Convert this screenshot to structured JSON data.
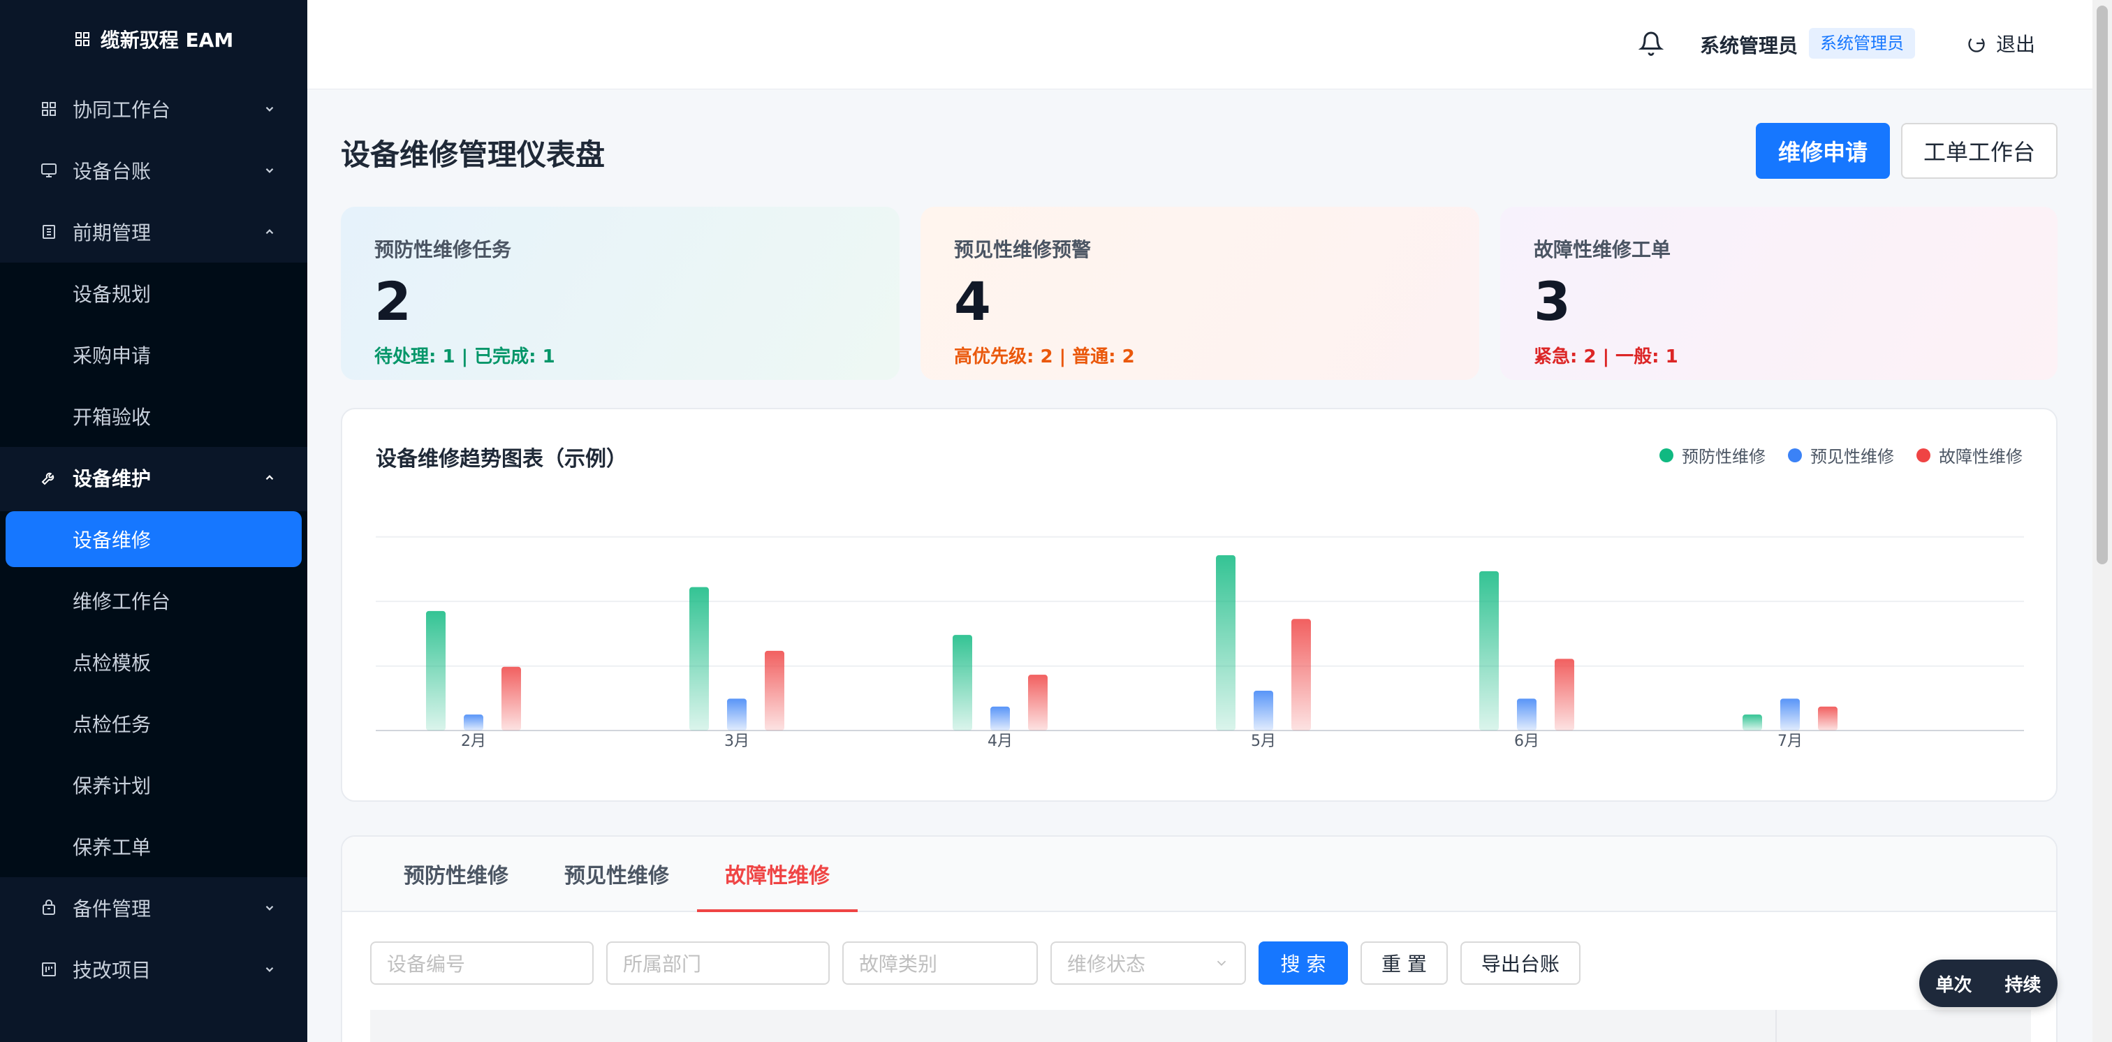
{
  "app": {
    "title": "缆新驭程 EAM"
  },
  "sidebar": {
    "groups": [
      {
        "label": "协同工作台",
        "icon": "grid-icon"
      },
      {
        "label": "设备台账",
        "icon": "monitor-icon"
      },
      {
        "label": "前期管理",
        "icon": "building-icon",
        "items": [
          "设备规划",
          "采购申请",
          "开箱验收"
        ]
      },
      {
        "label": "设备维护",
        "icon": "wrench-icon",
        "items": [
          "设备维修",
          "维修工作台",
          "点检模板",
          "点检任务",
          "保养计划",
          "保养工单"
        ],
        "selected": "设备维修"
      },
      {
        "label": "备件管理",
        "icon": "box-icon"
      },
      {
        "label": "技改项目",
        "icon": "project-icon"
      }
    ]
  },
  "header": {
    "user_name": "系统管理员",
    "role": "系统管理员",
    "logout": "退出"
  },
  "page": {
    "title": "设备维修管理仪表盘",
    "primary_action": "维修申请",
    "secondary_action": "工单工作台"
  },
  "stats": [
    {
      "title": "预防性维修任务",
      "value": "2",
      "sub": "待处理: 1 | 已完成: 1",
      "color": "#059669"
    },
    {
      "title": "预见性维修预警",
      "value": "4",
      "sub": "高优先级: 2 | 普通: 2",
      "color": "#ea580c"
    },
    {
      "title": "故障性维修工单",
      "value": "3",
      "sub": "紧急: 2 | 一般: 1",
      "color": "#dc2626"
    }
  ],
  "chart_data": {
    "type": "bar",
    "title": "设备维修趋势图表（示例）",
    "categories": [
      "2月",
      "3月",
      "4月",
      "5月",
      "6月",
      "7月"
    ],
    "series": [
      {
        "name": "预防性维修",
        "values": [
          15,
          18,
          12,
          22,
          20,
          2
        ],
        "color": "#10b981"
      },
      {
        "name": "预见性维修",
        "values": [
          2,
          4,
          3,
          5,
          4,
          4
        ],
        "color": "#3b82f6"
      },
      {
        "name": "故障性维修",
        "values": [
          8,
          10,
          7,
          14,
          9,
          3
        ],
        "color": "#ef4444"
      }
    ],
    "ylim": [
      0,
      27
    ],
    "grid": true,
    "legend": "top-right"
  },
  "tabs": {
    "items": [
      "预防性维修",
      "预见性维修",
      "故障性维修"
    ],
    "active": 2
  },
  "filters": {
    "device_no_placeholder": "设备编号",
    "dept_placeholder": "所属部门",
    "fault_type_placeholder": "故障类别",
    "status_placeholder": "维修状态",
    "search": "搜 索",
    "reset": "重 置",
    "export": "导出台账"
  },
  "mode_toggle": {
    "left": "单次",
    "right": "持续"
  }
}
